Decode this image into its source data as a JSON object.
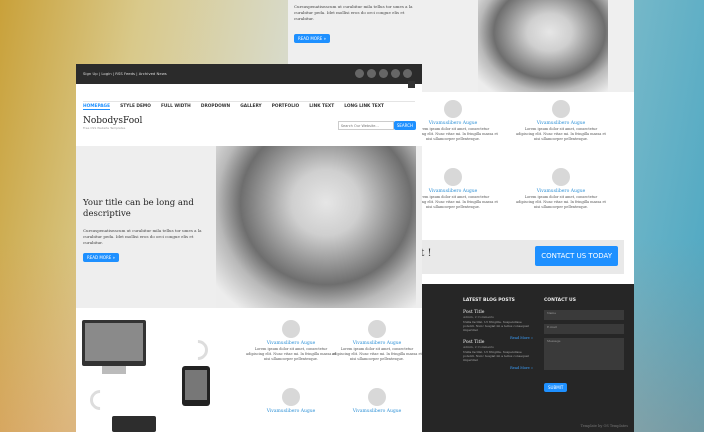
{
  "back": {
    "hero_text": "Cursuspenatiseacum ut curabitur mila tellus tor umes a la curabitur peda. Idet mollisi eros do orci congue elis et curabitur.",
    "read_more": "READ MORE »",
    "features": [
      {
        "title": "Vivamuslibero Augue",
        "text": "Lorem ipsum dolor sit amet, consectetur adipiscing elit. Nunc vitae mi. In fringilla massa et nisi ullamcorper pellentesque."
      },
      {
        "title": "Vivamuslibero Augue",
        "text": "Lorem ipsum dolor sit amet, consectetur adipiscing elit. Nunc vitae mi. In fringilla massa et nisi ullamcorper pellentesque."
      },
      {
        "title": "Vivamuslibero Augue",
        "text": "Lorem ipsum dolor sit amet, consectetur adipiscing elit. Nunc vitae mi. In fringilla massa et nisi ullamcorper pellentesque."
      },
      {
        "title": "Vivamuslibero Augue",
        "text": "Lorem ipsum dolor sit amet, consectetur adipiscing elit. Nunc vitae mi. In fringilla massa et nisi ullamcorper pellentesque."
      }
    ],
    "cta_text": "elit !",
    "cta_button": "CONTACT US TODAY",
    "footer": {
      "posts_heading": "LATEST BLOG POSTS",
      "contact_heading": "CONTACT US",
      "posts": [
        {
          "title": "Post Title",
          "meta": "Admin, 2 Comments",
          "text": "Nulla facilisi. Ut fringilla. Suspendisse potenti. Nunc feugiat mi a tellus consequat imperdiet"
        },
        {
          "title": "Post Title",
          "meta": "Admin, 2 Comments",
          "text": "Nulla facilisi. Ut fringilla. Suspendisse potenti. Nunc feugiat mi a tellus consequat imperdiet"
        }
      ],
      "read_more": "Read More »",
      "name_ph": "Name",
      "email_ph": "E-mail",
      "message_ph": "Message",
      "submit": "SUBMIT",
      "copyright": "Template by OS Templates"
    }
  },
  "main": {
    "top_links": "Sign Up | Login | RSS Feeds | Archived News",
    "nav": [
      "HOMEPAGE",
      "STYLE DEMO",
      "FULL WIDTH",
      "DROPDOWN",
      "GALLERY",
      "PORTFOLIO",
      "LINK TEXT",
      "LONG LINK TEXT"
    ],
    "logo": "NobodysFool",
    "tagline": "Free CSS Website Templates",
    "search_placeholder": "Search Our Website...",
    "search_button": "SEARCH",
    "hero_title": "Your title can be long and descriptive",
    "hero_text": "Cursuspenatiseacum ut curabitur mila tellus tor umes a la curabitur peda. Idet mollisi eros do orci congue elis et curabitur.",
    "read_more": "READ MORE »",
    "features": [
      {
        "title": "Vivamuslibero Augue",
        "text": "Lorem ipsum dolor sit amet, consectetur adipiscing elit. Nunc vitae mi. In fringilla massa et nisi ullamcorper pellentesque."
      },
      {
        "title": "Vivamuslibero Augue",
        "text": "Lorem ipsum dolor sit amet, consectetur adipiscing elit. Nunc vitae mi. In fringilla massa et nisi ullamcorper pellentesque."
      },
      {
        "title": "Vivamuslibero Augue",
        "text": ""
      },
      {
        "title": "Vivamuslibero Augue",
        "text": ""
      }
    ]
  },
  "colors": {
    "accent": "#1e90ff",
    "dark": "#2b2b2b"
  }
}
